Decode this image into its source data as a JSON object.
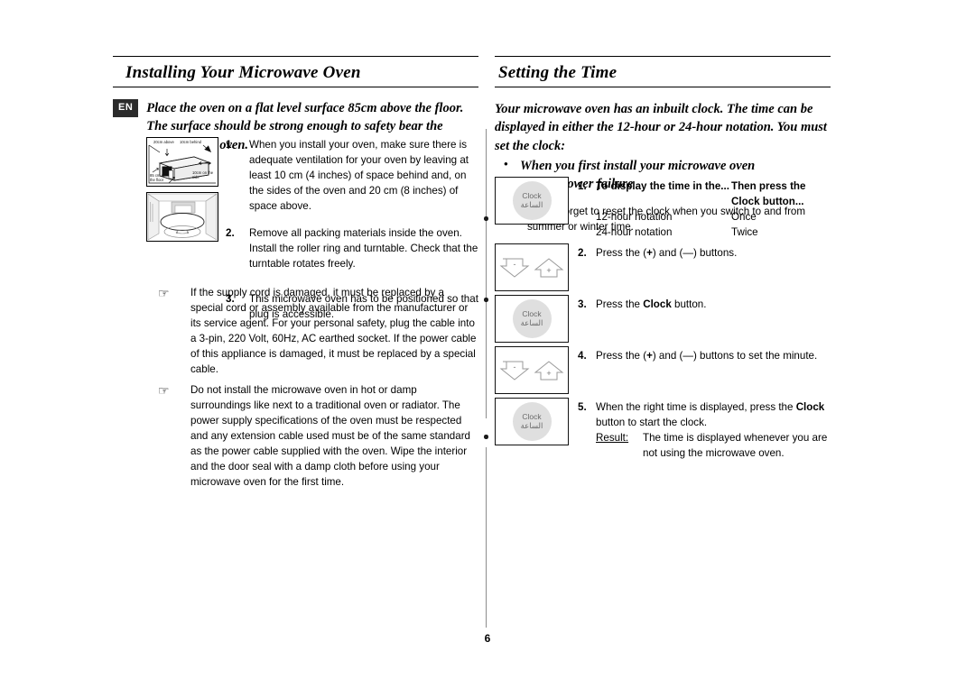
{
  "page": {
    "number": "6",
    "lang_tag": "EN"
  },
  "left": {
    "title": "Installing Your Microwave Oven",
    "intro": "Place the oven on a flat level surface 85cm above the floor. The surface should be strong enough to safety bear the weight of the oven.",
    "diagram": {
      "name": "oven-clearance-diagram",
      "labels": {
        "above": "20cm above",
        "behind": "10cm behind",
        "side": "10cm on the side",
        "floor": "85 cm of the floor"
      },
      "interior_name": "oven-interior-turntable-diagram"
    },
    "steps": [
      {
        "num": "1.",
        "text": "When you install your oven, make sure there is adequate ventilation for your oven by leaving at least 10 cm (4 inches) of space behind and, on the sides of the oven and 20 cm (8 inches) of space above."
      },
      {
        "num": "2.",
        "text": "Remove all packing materials inside the oven. Install the roller ring and turntable. Check that the turntable rotates freely."
      },
      {
        "num": "3.",
        "text": "This microwave oven has to be positioned so that plug is accessible."
      }
    ],
    "notes": [
      {
        "icon": "pointing-hand-icon",
        "text": "If the supply cord is damaged, it must be replaced by a special cord or assembly available from the manufacturer or its service agent. For your personal safety, plug the cable into a 3-pin, 220 Volt, 60Hz, AC earthed socket. If the power cable of this appliance is damaged, it must be replaced by a special cable."
      },
      {
        "icon": "pointing-hand-icon",
        "text": "Do not install the microwave oven in hot or damp surroundings like next to a traditional oven or radiator. The power supply specifications of the oven must be respected and any extension cable used must be of the same standard as the power cable supplied with the oven. Wipe the interior and the door seal with a damp cloth before using your microwave oven for the first time."
      }
    ]
  },
  "right": {
    "title": "Setting the Time",
    "intro": "Your microwave oven has an inbuilt clock. The time can be displayed in either the 12-hour or 24-hour notation. You must set the clock:",
    "bullets": [
      "When you first install your microwave oven",
      "After a power failure"
    ],
    "note": {
      "icon": "envelope-note-icon",
      "text": "Do not forget to reset the clock when you switch to and from summer or winter time."
    },
    "clock_button": {
      "label_en": "Clock",
      "label_ar": "الساعة"
    },
    "plus_minus_button": {
      "minus": "-",
      "plus": "+"
    },
    "steps": [
      {
        "num": "1.",
        "button": "clock",
        "table": {
          "head_col1": "To display the time in the...",
          "head_col2": "Then press the Clock button...",
          "rows": [
            {
              "c1": "12-hour notation",
              "c2": "Once"
            },
            {
              "c1": "24-hour notation",
              "c2": "Twice"
            }
          ]
        }
      },
      {
        "num": "2.",
        "button": "plus-minus",
        "text_pre": "Press the (",
        "text_mid": ") and (",
        "text_post": ") buttons.",
        "plus": "+",
        "minus": "—"
      },
      {
        "num": "3.",
        "button": "clock",
        "text_pre": "Press the ",
        "bold": "Clock",
        "text_post": " button."
      },
      {
        "num": "4.",
        "button": "plus-minus",
        "text_pre": "Press the (",
        "text_mid": ") and (",
        "text_post": ") buttons to set the minute.",
        "plus": "+",
        "minus": "—"
      },
      {
        "num": "5.",
        "button": "clock",
        "text_pre": "When the right time is displayed, press the ",
        "bold": "Clock",
        "text_post": " button to start the clock.",
        "result_label": "Result:",
        "result_text": "The time is displayed whenever you are not using the microwave oven."
      }
    ]
  }
}
